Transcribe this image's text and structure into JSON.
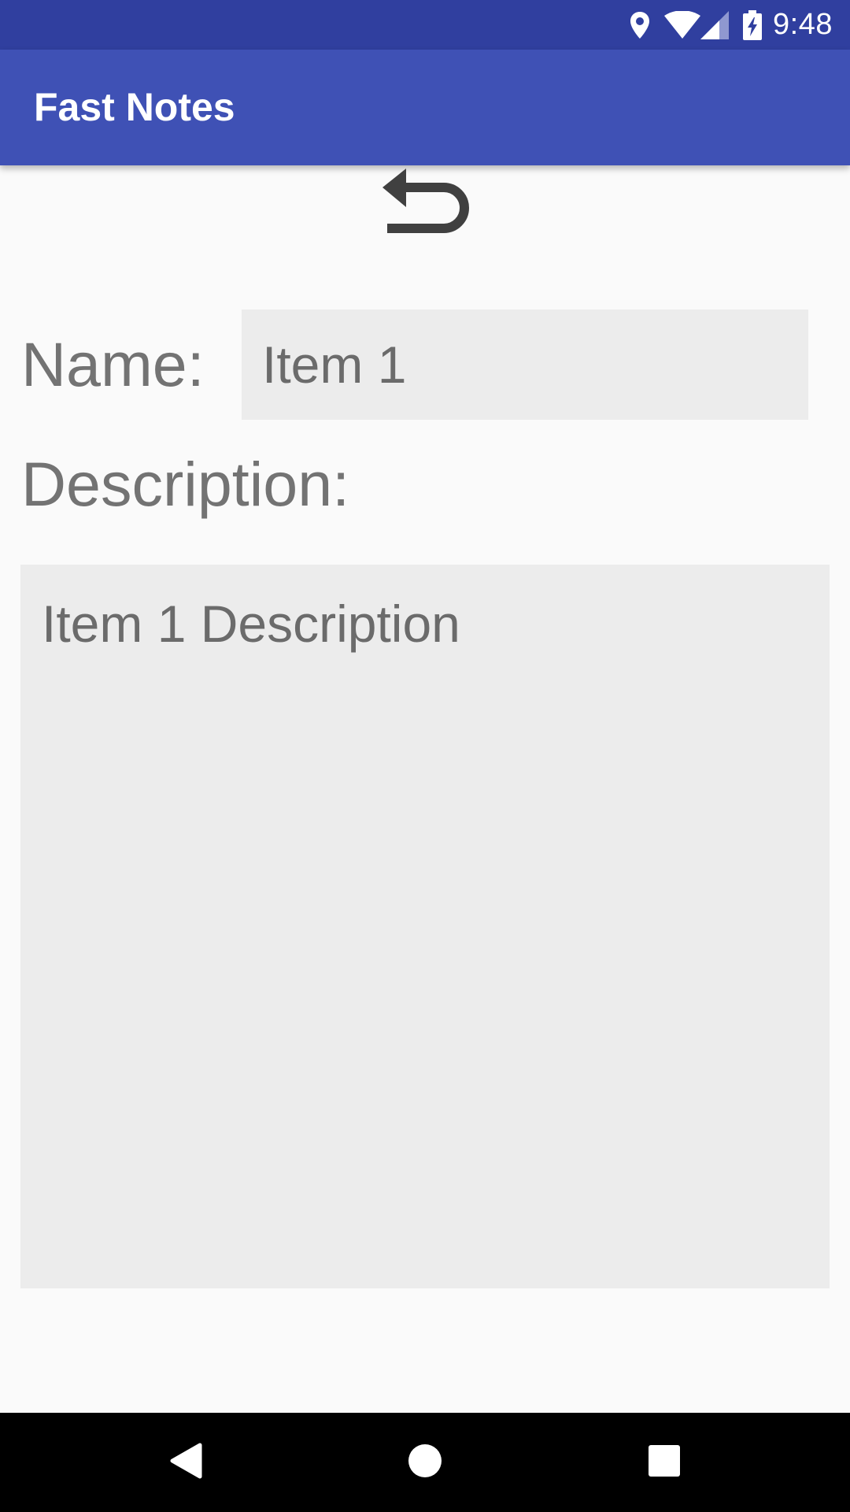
{
  "status_bar": {
    "time": "9:48",
    "icons": [
      "location-icon",
      "wifi-icon",
      "signal-icon",
      "battery-charging-icon"
    ],
    "background": "#303f9f"
  },
  "app_bar": {
    "title": "Fast Notes",
    "background": "#3f51b5"
  },
  "toolbar": {
    "undo_icon": "undo-icon"
  },
  "form": {
    "name_label": "Name:",
    "name_value": "Item 1",
    "description_label": "Description:",
    "description_value": "Item 1 Description",
    "field_background": "#ececec",
    "text_color": "#737373"
  },
  "nav_bar": {
    "icons": [
      "back-icon",
      "home-icon",
      "recents-icon"
    ],
    "background": "#000000"
  }
}
